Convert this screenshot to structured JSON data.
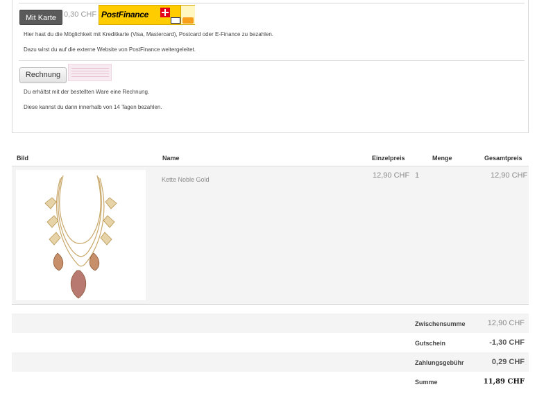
{
  "payment": {
    "card": {
      "button_label": "Mit Karte",
      "fee": "0,30 CHF",
      "logo_text": "PostFinance",
      "description_1": "Hier hast du die Möglichkeit mit Kreditkarte (Visa, Mastercard), Postcard oder E-Finance zu bezahlen.",
      "description_2": "Dazu wirst du auf die externe Website von PostFinance weitergeleitet."
    },
    "invoice": {
      "button_label": "Rechnung",
      "description_1": "Du erhältst mit der bestellten Ware eine Rechnung.",
      "description_2": "Diese kannst du dann innerhalb von 14 Tagen bezahlen."
    }
  },
  "cart": {
    "headers": {
      "image": "Bild",
      "name": "Name",
      "unit_price": "Einzelpreis",
      "quantity": "Menge",
      "total": "Gesamtpreis"
    },
    "items": [
      {
        "name": "Kette Noble Gold",
        "unit_price": "12,90 CHF",
        "quantity": "1",
        "total": "12,90 CHF"
      }
    ]
  },
  "totals": {
    "subtotal_label": "Zwischensumme",
    "subtotal_value": "12,90 CHF",
    "voucher_label": "Gutschein",
    "voucher_value": "-1,30 CHF",
    "fee_label": "Zahlungsgebühr",
    "fee_value": "0,29 CHF",
    "sum_label": "Summe",
    "sum_value": "11,89 CHF"
  },
  "colors": {
    "postfinance_yellow": "#ffcc00",
    "postfinance_red": "#e2001a",
    "selected_button": "#5a5a5a"
  }
}
